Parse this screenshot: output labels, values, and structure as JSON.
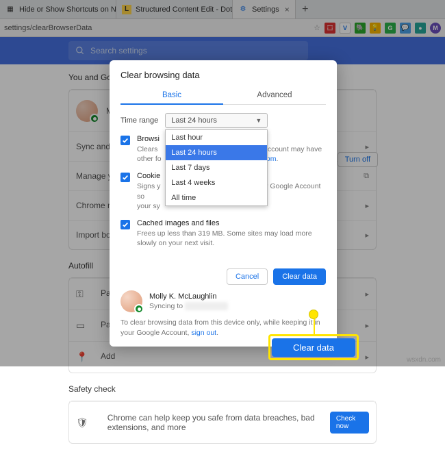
{
  "tabs": [
    {
      "label": "Hide or Show Shortcuts on New"
    },
    {
      "label": "Structured Content Edit - Dotda"
    },
    {
      "label": "Settings"
    }
  ],
  "address": "settings/clearBrowserData",
  "search_placeholder": "Search settings",
  "section_you": "You and Goo",
  "sync_row": "Sync and G",
  "manage_row": "Manage yo",
  "chrome_name_row": "Chrome na",
  "import_row": "Import boo",
  "autofill_title": "Autofill",
  "af_pass": "Pas",
  "af_pay": "Pay",
  "af_add": "Add",
  "safety_title": "Safety check",
  "safety_desc": "Chrome can help keep you safe from data breaches, bad extensions, and more",
  "check_now": "Check now",
  "turn_off": "Turn off",
  "dialog": {
    "title": "Clear browsing data",
    "tab_basic": "Basic",
    "tab_advanced": "Advanced",
    "time_label": "Time range",
    "selected": "Last 24 hours",
    "options": [
      "Last hour",
      "Last 24 hours",
      "Last 7 days",
      "Last 4 weeks",
      "All time"
    ],
    "browsing": {
      "title": "Browsi",
      "desc_a": "Clears",
      "desc_b": "Your Google Account may have",
      "desc_c": "other fo",
      "desc_link": "ivity.google.com"
    },
    "cookies": {
      "title": "Cookie",
      "desc_a": "Signs y",
      "desc_b": "ned in to your Google Account so",
      "desc_c": "your sy"
    },
    "cached": {
      "title": "Cached images and files",
      "desc": "Frees up less than 319 MB. Some sites may load more slowly on your next visit."
    },
    "cancel": "Cancel",
    "clear": "Clear data",
    "account_name": "Molly K. McLaughlin",
    "syncing": "Syncing to",
    "footnote_a": "To clear browsing data from this device only, while keeping it in your Google Account,",
    "signout": "sign out"
  },
  "callout_label": "Clear data",
  "watermark": "wsxdn.com"
}
